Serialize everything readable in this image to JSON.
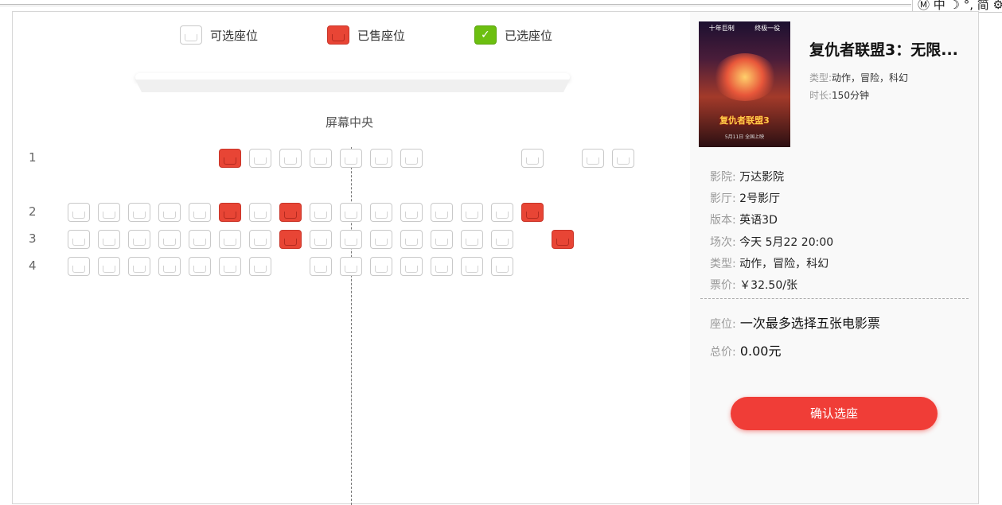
{
  "ime": {
    "text": "Ⓜ 中 ☽ °, 简 ⚙"
  },
  "legend": [
    {
      "label": "可选座位",
      "type": "available"
    },
    {
      "label": "已售座位",
      "type": "sold"
    },
    {
      "label": "已选座位",
      "type": "selected"
    }
  ],
  "screen": {
    "label": "屏幕中央"
  },
  "rows": [
    {
      "num": "1",
      "seats": [
        "gap",
        "gap",
        "gap",
        "gap",
        "gap",
        "sold",
        "avail",
        "avail",
        "avail",
        "avail",
        "avail",
        "avail",
        "gap",
        "gap",
        "gap",
        "avail",
        "gap",
        "avail",
        "avail"
      ]
    },
    {
      "num": "2",
      "seats": [
        "avail",
        "avail",
        "avail",
        "avail",
        "avail",
        "sold",
        "avail",
        "sold",
        "avail",
        "avail",
        "avail",
        "avail",
        "avail",
        "avail",
        "avail",
        "sold"
      ]
    },
    {
      "num": "3",
      "seats": [
        "avail",
        "avail",
        "avail",
        "avail",
        "avail",
        "avail",
        "avail",
        "sold",
        "avail",
        "avail",
        "avail",
        "avail",
        "avail",
        "avail",
        "avail",
        "gap",
        "sold"
      ]
    },
    {
      "num": "4",
      "seats": [
        "avail",
        "avail",
        "avail",
        "avail",
        "avail",
        "avail",
        "avail",
        "gap",
        "avail",
        "avail",
        "avail",
        "avail",
        "avail",
        "avail",
        "avail"
      ]
    }
  ],
  "movie": {
    "title": "复仇者联盟3：无限...",
    "genre_label": "类型:",
    "genre": "动作，冒险，科幻",
    "duration_label": "时长:",
    "duration": "150分钟",
    "poster": {
      "sub_left": "十年巨制",
      "sub_right": "终极一役",
      "title": "复仇者联盟3",
      "foot": "5月11日 全国上映"
    }
  },
  "info": {
    "cinema_label": "影院:",
    "cinema": "万达影院",
    "hall_label": "影厅:",
    "hall": "2号影厅",
    "version_label": "版本:",
    "version": "英语3D",
    "session_label": "场次:",
    "session": "今天 5月22 20:00",
    "type_label": "类型:",
    "type": "动作，冒险，科幻",
    "price_label": "票价:",
    "price": "￥32.50/张",
    "seat_label": "座位:",
    "seat": "一次最多选择五张电影票",
    "total_label": "总价:",
    "total": "0.00元"
  },
  "confirm_label": "确认选座",
  "colors": {
    "sold": "#e84535",
    "selected": "#6cbf10",
    "accent": "#f03d37"
  }
}
